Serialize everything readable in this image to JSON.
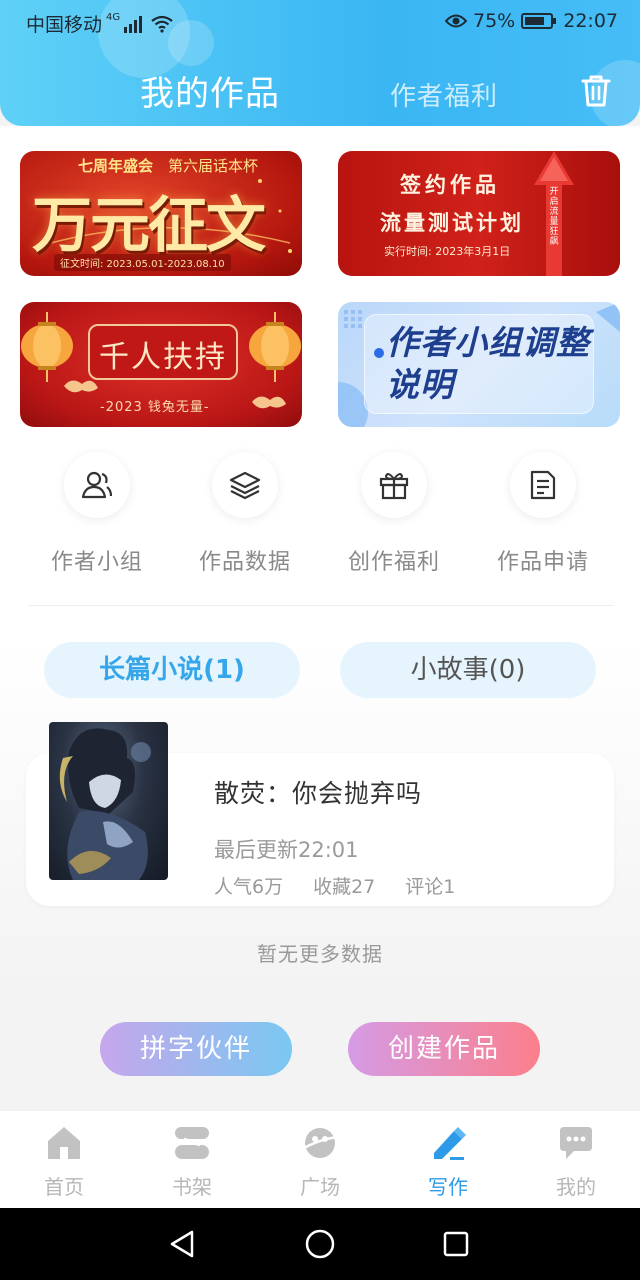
{
  "status_bar": {
    "carrier": "中国移动",
    "network_tag": "4G",
    "battery": "75%",
    "time": "22:07"
  },
  "header": {
    "active_tab": "我的作品",
    "other_tab": "作者福利",
    "trash_icon": "trash-icon"
  },
  "banners": [
    {
      "top_left": "七周年盛会",
      "top_right": "第六届话本杯",
      "main": "万元征文",
      "date": "征文时间: 2023.05.01-2023.08.10"
    },
    {
      "line1": "签约作品",
      "line2": "流量测试计划",
      "line3": "实行时间: 2023年3月1日",
      "vertical": "开启流量狂飙"
    },
    {
      "main": "千人扶持",
      "sub": "-2023 钱兔无量-"
    },
    {
      "main": "作者小组调整说明"
    }
  ],
  "quick_links": [
    {
      "label": "作者小组",
      "icon": "users-icon"
    },
    {
      "label": "作品数据",
      "icon": "layers-icon"
    },
    {
      "label": "创作福利",
      "icon": "gift-icon"
    },
    {
      "label": "作品申请",
      "icon": "document-icon"
    }
  ],
  "category_tabs": {
    "novel": "长篇小说(1)",
    "story": "小故事(0)"
  },
  "work": {
    "title": "散荧：你会抛弃吗",
    "updated": "最后更新22:01",
    "popularity": "人气6万",
    "favorites": "收藏27",
    "comments": "评论1"
  },
  "no_more": "暂无更多数据",
  "actions": {
    "partner": "拼字伙伴",
    "create": "创建作品"
  },
  "bottom_nav": [
    {
      "label": "首页",
      "icon": "home-icon"
    },
    {
      "label": "书架",
      "icon": "bookshelf-icon"
    },
    {
      "label": "广场",
      "icon": "planet-icon"
    },
    {
      "label": "写作",
      "icon": "pen-icon"
    },
    {
      "label": "我的",
      "icon": "chat-bubble-icon"
    }
  ],
  "colors": {
    "accent": "#35a6e9",
    "header": "#3ab6f3",
    "active_nav": "#2e9be8"
  }
}
